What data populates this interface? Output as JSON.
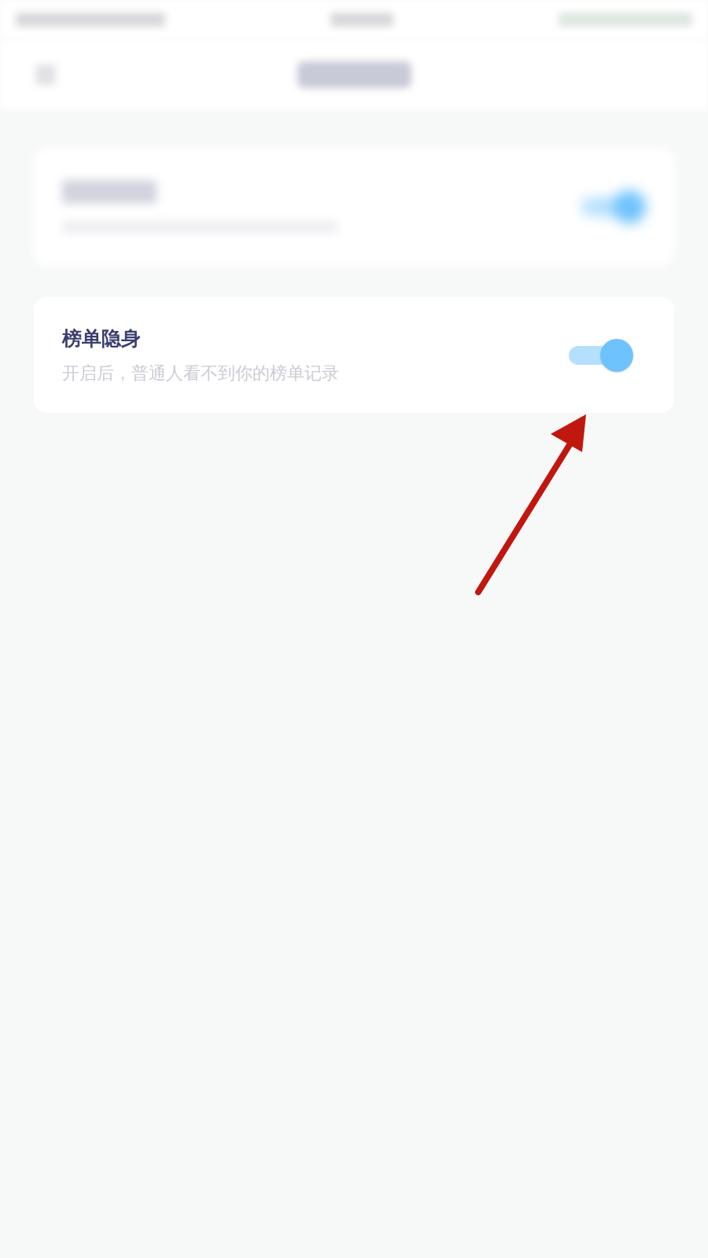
{
  "settings": [
    {
      "kind": "blurred",
      "on": true
    },
    {
      "kind": "toggle",
      "title": "榜单隐身",
      "description": "开启后，普通人看不到你的榜单记录",
      "on": true
    }
  ]
}
